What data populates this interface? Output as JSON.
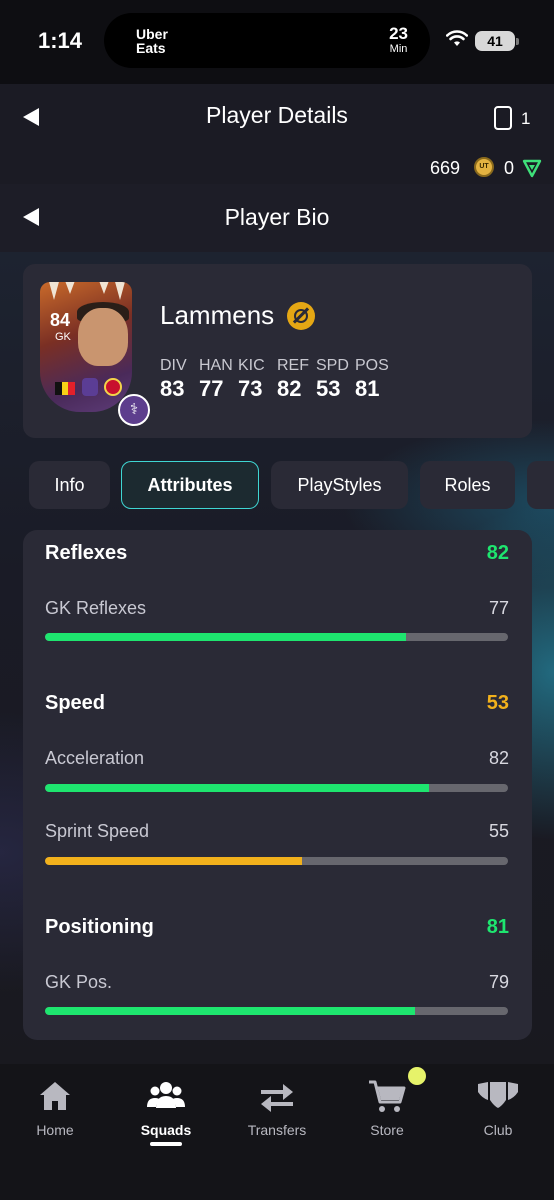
{
  "status_bar": {
    "time": "1:14",
    "live_activity": {
      "brand_line1": "Uber",
      "brand_line2": "Eats",
      "eta_value": "23",
      "eta_unit": "Min"
    },
    "battery": "41"
  },
  "header": {
    "title": "Player Details",
    "card_slot_count": "1",
    "coins": "669",
    "coin_icon_text": "UT",
    "points": "0"
  },
  "subheader": {
    "title": "Player Bio"
  },
  "player": {
    "name": "Lammens",
    "card": {
      "rating": "84",
      "position": "GK"
    },
    "stats": [
      {
        "label": "DIV",
        "value": "83"
      },
      {
        "label": "HAN",
        "value": "77"
      },
      {
        "label": "KIC",
        "value": "73"
      },
      {
        "label": "REF",
        "value": "82"
      },
      {
        "label": "SPD",
        "value": "53"
      },
      {
        "label": "POS",
        "value": "81"
      }
    ]
  },
  "tabs": [
    {
      "label": "Info",
      "active": false
    },
    {
      "label": "Attributes",
      "active": true
    },
    {
      "label": "PlayStyles",
      "active": false
    },
    {
      "label": "Roles",
      "active": false
    }
  ],
  "attributes": [
    {
      "title": "Reflexes",
      "value": "82",
      "color": "#1ee56f",
      "items": [
        {
          "label": "GK Reflexes",
          "value": "77",
          "fill": 0.78,
          "color": "#1ee56f"
        }
      ]
    },
    {
      "title": "Speed",
      "value": "53",
      "color": "#f2b11c",
      "items": [
        {
          "label": "Acceleration",
          "value": "82",
          "fill": 0.83,
          "color": "#1ee56f"
        },
        {
          "label": "Sprint Speed",
          "value": "55",
          "fill": 0.555,
          "color": "#f2b11c"
        }
      ]
    },
    {
      "title": "Positioning",
      "value": "81",
      "color": "#1ee56f",
      "items": [
        {
          "label": "GK Pos.",
          "value": "79",
          "fill": 0.8,
          "color": "#1ee56f"
        }
      ]
    }
  ],
  "bottom_nav": [
    {
      "label": "Home",
      "icon": "home-icon",
      "active": false
    },
    {
      "label": "Squads",
      "icon": "squads-icon",
      "active": true
    },
    {
      "label": "Transfers",
      "icon": "transfers-icon",
      "active": false
    },
    {
      "label": "Store",
      "icon": "cart-icon",
      "active": false
    },
    {
      "label": "Club",
      "icon": "club-icon",
      "active": false
    }
  ],
  "colors": {
    "accent": "#3fd6d3",
    "good": "#1ee56f",
    "average": "#f2b11c",
    "bar_track": "#67676e"
  }
}
